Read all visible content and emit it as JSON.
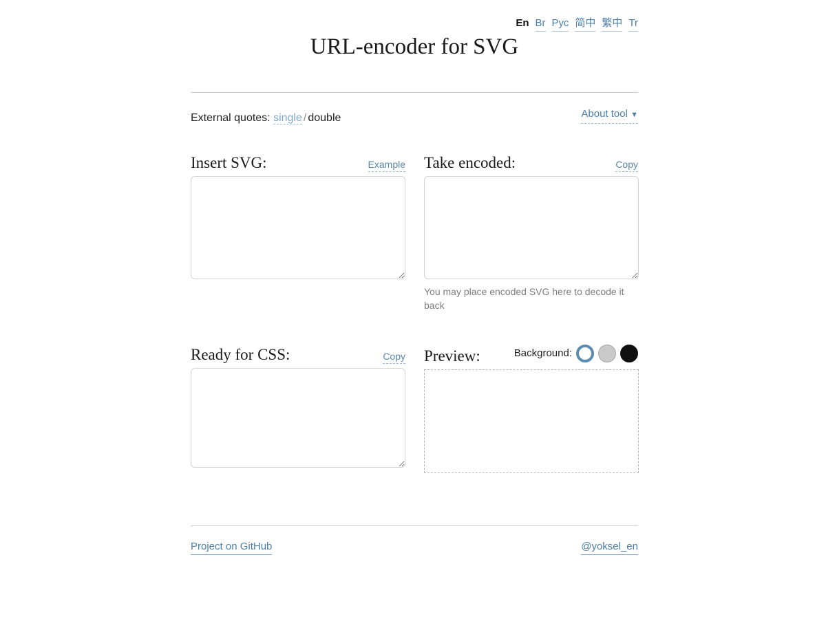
{
  "page": {
    "title": "URL-encoder for SVG"
  },
  "languages": {
    "current": "En",
    "items": [
      {
        "label": "En",
        "active": true
      },
      {
        "label": "Br",
        "active": false
      },
      {
        "label": "Рус",
        "active": false
      },
      {
        "label": "简中",
        "active": false
      },
      {
        "label": "繁中",
        "active": false
      },
      {
        "label": "Tr",
        "active": false
      }
    ]
  },
  "options": {
    "quotes_label": "External quotes:",
    "quotes_single": "single",
    "quotes_separator": "/",
    "quotes_double": "double",
    "quotes_selected": "single",
    "about_label": "About tool",
    "about_caret": "▼"
  },
  "insert": {
    "heading": "Insert SVG:",
    "action_label": "Example",
    "value": "",
    "placeholder": ""
  },
  "encoded": {
    "heading": "Take encoded:",
    "action_label": "Copy",
    "value": "",
    "placeholder": "",
    "hint": "You may place encoded SVG here to decode it back"
  },
  "css": {
    "heading": "Ready for CSS:",
    "action_label": "Copy",
    "value": "",
    "placeholder": ""
  },
  "preview": {
    "heading": "Preview:",
    "background_label": "Background:",
    "backgrounds": [
      {
        "name": "white",
        "color": "#ffffff",
        "selected": true
      },
      {
        "name": "gray",
        "color": "#c9c9c9",
        "selected": false
      },
      {
        "name": "black",
        "color": "#101010",
        "selected": false
      }
    ]
  },
  "footer": {
    "project_link": "Project on GitHub",
    "author_link": "@yoksel_en"
  },
  "colors": {
    "accent": "#4c7fa8",
    "dashed_link": "#7fa8c4",
    "rule": "#cccccc",
    "hint_text": "#7d7d7d",
    "selected_ring": "#5b8cb0"
  }
}
